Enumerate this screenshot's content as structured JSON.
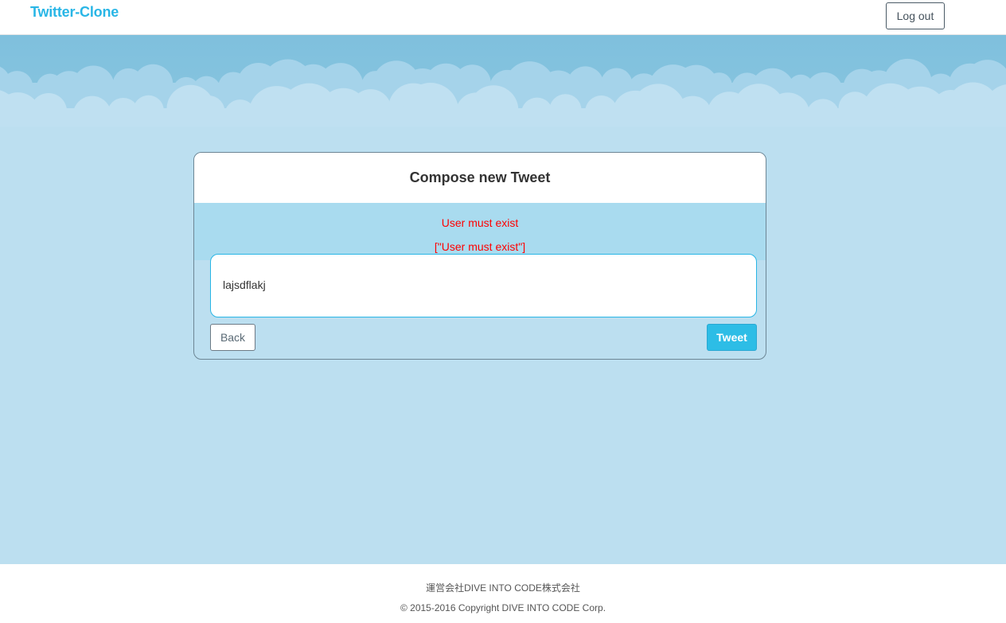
{
  "navbar": {
    "brand": "Twitter-Clone",
    "logout_label": "Log out"
  },
  "compose": {
    "title": "Compose new Tweet",
    "errors": [
      "User must exist",
      "[\"User must exist\"]"
    ],
    "content": "lajsdflakj",
    "back_label": "Back",
    "tweet_label": "Tweet"
  },
  "footer": {
    "company": "運営会社DIVE INTO CODE株式会社",
    "copyright": "© 2015-2016 Copyright DIVE INTO CODE Corp."
  },
  "colors": {
    "brand": "#29b6e6",
    "sky": "#bcdff0",
    "error": "#ff0000",
    "tweet_button": "#2dbde6"
  }
}
